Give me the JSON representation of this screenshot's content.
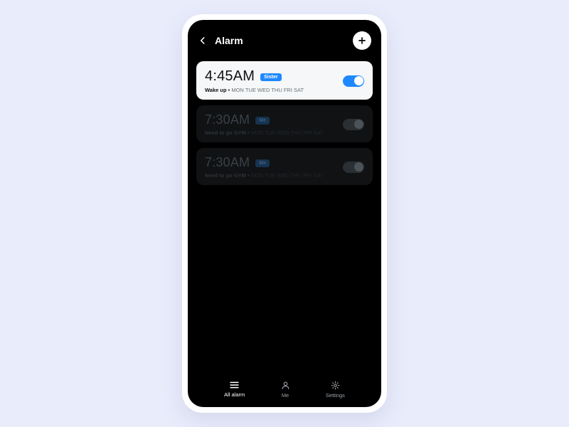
{
  "header": {
    "title": "Alarm"
  },
  "alarms": [
    {
      "time": "4:45AM",
      "tag": "Sister",
      "label": "Wake up",
      "days": "MON TUE WED THU FRI SAT",
      "enabled": true
    },
    {
      "time": "7:30AM",
      "tag": "Me",
      "label": "Need to go GYM",
      "days": "MON TUE WED THU FRI SAT",
      "enabled": false
    },
    {
      "time": "7:30AM",
      "tag": "Me",
      "label": "Need to go GYM",
      "days": "MON TUE WED THU FRI SAT",
      "enabled": false
    }
  ],
  "tabs": {
    "all": "All alarm",
    "me": "Me",
    "settings": "Settings"
  }
}
